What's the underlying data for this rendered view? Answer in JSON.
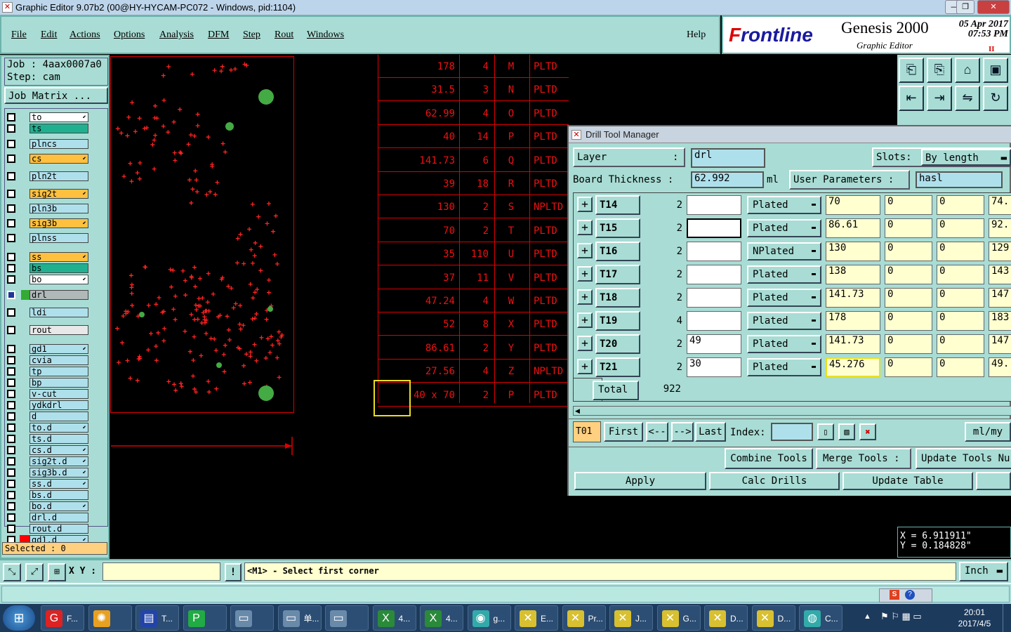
{
  "window": {
    "title": "Graphic Editor 9.07b2 (00@HY-HYCAM-PC072 - Windows, pid:1104)",
    "min": "—",
    "max": "❐",
    "close": "✕"
  },
  "menu": [
    "File",
    "Edit",
    "Actions",
    "Options",
    "Analysis",
    "DFM",
    "Step",
    "Rout",
    "Windows"
  ],
  "help": "Help",
  "logo": {
    "brand_prefix": "F",
    "brand_rest": "rontline",
    "product": "Genesis 2000",
    "subtitle": "Graphic Editor",
    "date": "05 Apr 2017",
    "time": "07:53 PM",
    "marker": "II"
  },
  "job": {
    "job_line": "Job : 4aax0007a0",
    "step_line": "Step: cam",
    "matrix_button": "Job Matrix ..."
  },
  "layers": [
    {
      "name": "to",
      "color": "#ffffff",
      "arrow": true
    },
    {
      "name": "ts",
      "color": "#20b090",
      "arrow": false
    },
    {
      "name": "plncs",
      "color": "#aee0ec",
      "arrow": false
    },
    {
      "name": "cs",
      "color": "#ffc040",
      "arrow": true
    },
    {
      "name": "pln2t",
      "color": "#aee0ec",
      "arrow": false
    },
    {
      "name": "sig2t",
      "color": "#ffc040",
      "arrow": true
    },
    {
      "name": "pln3b",
      "color": "#aee0ec",
      "arrow": false
    },
    {
      "name": "sig3b",
      "color": "#ffc040",
      "arrow": true
    },
    {
      "name": "plnss",
      "color": "#aee0ec",
      "arrow": false
    },
    {
      "name": "ss",
      "color": "#ffc040",
      "arrow": true
    },
    {
      "name": "bs",
      "color": "#20b090",
      "arrow": false
    },
    {
      "name": "bo",
      "color": "#ffffff",
      "arrow": true
    },
    {
      "name": "drl",
      "color": "#b0b8b8",
      "arrow": false
    },
    {
      "name": "ldi",
      "color": "#aee0ec",
      "arrow": false
    },
    {
      "name": "rout",
      "color": "#e8e8e8",
      "arrow": false
    },
    {
      "name": "gd1",
      "color": "#aee0ec",
      "arrow": true
    },
    {
      "name": "cvia",
      "color": "#aee0ec",
      "arrow": false
    },
    {
      "name": "tp",
      "color": "#aee0ec",
      "arrow": false
    },
    {
      "name": "bp",
      "color": "#aee0ec",
      "arrow": false
    },
    {
      "name": "v-cut",
      "color": "#aee0ec",
      "arrow": false
    },
    {
      "name": "ydkdrl",
      "color": "#aee0ec",
      "arrow": false
    },
    {
      "name": "d",
      "color": "#aee0ec",
      "arrow": false
    },
    {
      "name": "to.d",
      "color": "#aee0ec",
      "arrow": true
    },
    {
      "name": "ts.d",
      "color": "#aee0ec",
      "arrow": false
    },
    {
      "name": "cs.d",
      "color": "#aee0ec",
      "arrow": true
    },
    {
      "name": "sig2t.d",
      "color": "#aee0ec",
      "arrow": true
    },
    {
      "name": "sig3b.d",
      "color": "#aee0ec",
      "arrow": true
    },
    {
      "name": "ss.d",
      "color": "#aee0ec",
      "arrow": true
    },
    {
      "name": "bs.d",
      "color": "#aee0ec",
      "arrow": false
    },
    {
      "name": "bo.d",
      "color": "#aee0ec",
      "arrow": true
    },
    {
      "name": "drl.d",
      "color": "#aee0ec",
      "arrow": false
    },
    {
      "name": "rout.d",
      "color": "#aee0ec",
      "arrow": false
    },
    {
      "name": "gd1.d",
      "color": "#aee0ec",
      "arrow": true
    }
  ],
  "selected": "Selected : 0",
  "drill_table": [
    {
      "size": "178",
      "count": "4",
      "letter": "M",
      "type": "PLTD"
    },
    {
      "size": "31.5",
      "count": "3",
      "letter": "N",
      "type": "PLTD"
    },
    {
      "size": "62.99",
      "count": "4",
      "letter": "O",
      "type": "PLTD"
    },
    {
      "size": "40",
      "count": "14",
      "letter": "P",
      "type": "PLTD"
    },
    {
      "size": "141.73",
      "count": "6",
      "letter": "Q",
      "type": "PLTD"
    },
    {
      "size": "39",
      "count": "18",
      "letter": "R",
      "type": "PLTD"
    },
    {
      "size": "130",
      "count": "2",
      "letter": "S",
      "type": "NPLTD"
    },
    {
      "size": "70",
      "count": "2",
      "letter": "T",
      "type": "PLTD"
    },
    {
      "size": "35",
      "count": "110",
      "letter": "U",
      "type": "PLTD"
    },
    {
      "size": "37",
      "count": "11",
      "letter": "V",
      "type": "PLTD"
    },
    {
      "size": "47.24",
      "count": "4",
      "letter": "W",
      "type": "PLTD"
    },
    {
      "size": "52",
      "count": "8",
      "letter": "X",
      "type": "PLTD"
    },
    {
      "size": "86.61",
      "count": "2",
      "letter": "Y",
      "type": "PLTD"
    },
    {
      "size": "27.56",
      "count": "4",
      "letter": "Z",
      "type": "NPLTD"
    },
    {
      "size": "40 x 70",
      "count": "2",
      "letter": "P",
      "type": "PLTD"
    }
  ],
  "dtm": {
    "title": "Drill Tool Manager",
    "layer_label": "Layer",
    "colon": ":",
    "layer_value": "drl",
    "slots_label": "Slots:",
    "slots_value": "By length",
    "thickness_label": "Board Thickness :",
    "thickness_value": "62.992",
    "thickness_unit": "ml",
    "user_params_label": "User Parameters :",
    "user_params_value": "hasl",
    "tools": [
      {
        "id": "T14",
        "count": "2",
        "finish": "",
        "type": "Plated",
        "size": "70",
        "a": "0",
        "b": "0",
        "drill": "74."
      },
      {
        "id": "T15",
        "count": "2",
        "finish": "",
        "type": "Plated",
        "size": "86.61",
        "a": "0",
        "b": "0",
        "drill": "92."
      },
      {
        "id": "T16",
        "count": "2",
        "finish": "",
        "type": "NPlated",
        "size": "130",
        "a": "0",
        "b": "0",
        "drill": "129"
      },
      {
        "id": "T17",
        "count": "2",
        "finish": "",
        "type": "Plated",
        "size": "138",
        "a": "0",
        "b": "0",
        "drill": "143"
      },
      {
        "id": "T18",
        "count": "2",
        "finish": "",
        "type": "Plated",
        "size": "141.73",
        "a": "0",
        "b": "0",
        "drill": "147"
      },
      {
        "id": "T19",
        "count": "4",
        "finish": "",
        "type": "Plated",
        "size": "178",
        "a": "0",
        "b": "0",
        "drill": "183"
      },
      {
        "id": "T20",
        "count": "2",
        "finish": "49",
        "type": "Plated",
        "size": "141.73",
        "a": "0",
        "b": "0",
        "drill": "147"
      },
      {
        "id": "T21",
        "count": "2",
        "finish": "30",
        "type": "Plated",
        "size": "45.276",
        "a": "0",
        "b": "0",
        "drill": "49."
      }
    ],
    "total_label": "Total",
    "total_value": "922",
    "current_tool": "T01",
    "first": "First",
    "prev": "<--",
    "next": "-->",
    "last": "Last",
    "index_label": "Index:",
    "index_value": "",
    "units": "ml/my",
    "combine": "Combine Tools",
    "merge": "Merge Tools :",
    "update_numbers": "Update Tools Nu",
    "apply": "Apply",
    "calc": "Calc Drills",
    "update_table": "Update Table"
  },
  "coords": {
    "x": "X = 6.911911\"",
    "y": "Y = 0.184828\""
  },
  "bottom": {
    "xy_label": "X Y :",
    "xy_value": "",
    "warn": "!",
    "prompt": "<M1> - Select first corner",
    "unit": "Inch"
  },
  "taskbar": {
    "items": [
      {
        "label": "F...",
        "icon": "G",
        "color": "#d22"
      },
      {
        "label": "",
        "icon": "✺",
        "color": "#e8a020"
      },
      {
        "label": "T...",
        "icon": "▤",
        "color": "#2244aa"
      },
      {
        "label": "",
        "icon": "P",
        "color": "#22aa44"
      },
      {
        "label": "",
        "icon": "▭",
        "color": "#6a8aaa"
      },
      {
        "label": "单...",
        "icon": "▭",
        "color": "#6a8aaa"
      },
      {
        "label": "",
        "icon": "▭",
        "color": "#6a8aaa"
      },
      {
        "label": "4...",
        "icon": "X",
        "color": "#2a8a3a"
      },
      {
        "label": "4...",
        "icon": "X",
        "color": "#2a8a3a"
      },
      {
        "label": "g...",
        "icon": "◉",
        "color": "#3aa"
      },
      {
        "label": "E...",
        "icon": "✕",
        "color": "#d8c030"
      },
      {
        "label": "Pr...",
        "icon": "✕",
        "color": "#d8c030"
      },
      {
        "label": "J...",
        "icon": "✕",
        "color": "#d8c030"
      },
      {
        "label": "G...",
        "icon": "✕",
        "color": "#d8c030"
      },
      {
        "label": "D...",
        "icon": "✕",
        "color": "#d8c030"
      },
      {
        "label": "D...",
        "icon": "✕",
        "color": "#d8c030"
      },
      {
        "label": "C...",
        "icon": "◍",
        "color": "#3aa"
      }
    ],
    "time": "20:01",
    "date": "2017/4/5"
  }
}
